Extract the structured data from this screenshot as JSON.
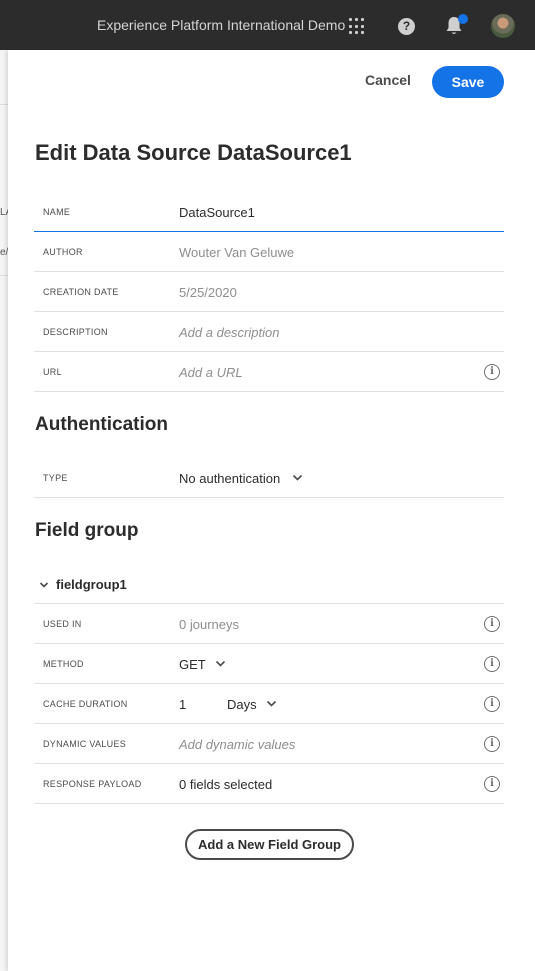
{
  "topbar": {
    "org_name": "Experience Platform International Demo",
    "icons": [
      "apps-icon",
      "help-icon",
      "bell-icon",
      "avatar"
    ],
    "help_glyph": "?"
  },
  "background_fragments": [
    "LA",
    "e/"
  ],
  "toolbar": {
    "cancel_label": "Cancel",
    "save_label": "Save"
  },
  "page": {
    "title": "Edit Data Source DataSource1"
  },
  "details": {
    "name": {
      "label": "NAME",
      "value": "DataSource1"
    },
    "author": {
      "label": "AUTHOR",
      "value": "Wouter Van Geluwe"
    },
    "creation_date": {
      "label": "CREATION DATE",
      "value": "5/25/2020"
    },
    "description": {
      "label": "DESCRIPTION",
      "placeholder": "Add a description"
    },
    "url": {
      "label": "URL",
      "placeholder": "Add a URL"
    }
  },
  "authentication": {
    "title": "Authentication",
    "type": {
      "label": "TYPE",
      "value": "No authentication"
    }
  },
  "field_group": {
    "title": "Field group",
    "name": "fieldgroup1",
    "used_in": {
      "label": "USED IN",
      "value": "0 journeys"
    },
    "method": {
      "label": "METHOD",
      "value": "GET"
    },
    "cache_duration": {
      "label": "CACHE DURATION",
      "value": "1",
      "unit": "Days"
    },
    "dynamic_values": {
      "label": "DYNAMIC VALUES",
      "placeholder": "Add dynamic values"
    },
    "response_payload": {
      "label": "RESPONSE PAYLOAD",
      "value": "0 fields selected"
    }
  },
  "add_field_group_label": "Add a New Field Group",
  "info_glyph": "i",
  "colors": {
    "accent": "#1473e6",
    "topbar": "#2c2c2c",
    "text": "#2c2c2c",
    "muted": "#8e8e8e"
  }
}
